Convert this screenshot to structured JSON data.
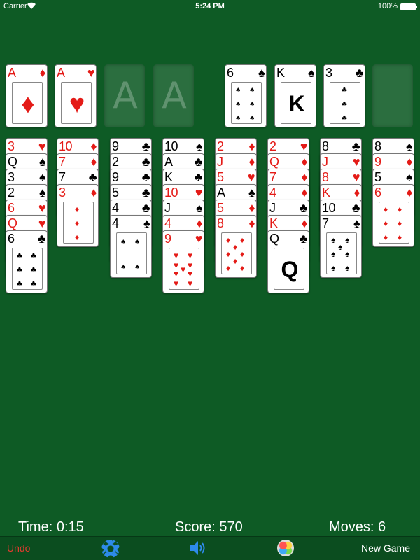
{
  "status": {
    "carrier": "Carrier",
    "time": "5:24 PM",
    "battery": "100%"
  },
  "foundations": [
    {
      "rank": "A",
      "suit": "♦",
      "color": "red"
    },
    {
      "rank": "A",
      "suit": "♥",
      "color": "red"
    },
    {
      "empty_label": "A"
    },
    {
      "empty_label": "A"
    }
  ],
  "free_cells": [
    {
      "rank": "6",
      "suit": "♠",
      "color": "black",
      "pips": 6
    },
    {
      "rank": "K",
      "suit": "♠",
      "color": "black",
      "face": "K"
    },
    {
      "rank": "3",
      "suit": "♣",
      "color": "black",
      "pips": 3
    },
    {
      "empty": true
    }
  ],
  "tableau": [
    [
      {
        "rank": "3",
        "suit": "♥",
        "color": "red"
      },
      {
        "rank": "Q",
        "suit": "♠",
        "color": "black"
      },
      {
        "rank": "3",
        "suit": "♠",
        "color": "black"
      },
      {
        "rank": "2",
        "suit": "♠",
        "color": "black"
      },
      {
        "rank": "6",
        "suit": "♥",
        "color": "red"
      },
      {
        "rank": "Q",
        "suit": "♥",
        "color": "red"
      },
      {
        "rank": "6",
        "suit": "♣",
        "color": "black",
        "pips": 6
      }
    ],
    [
      {
        "rank": "10",
        "suit": "♦",
        "color": "red"
      },
      {
        "rank": "7",
        "suit": "♦",
        "color": "red"
      },
      {
        "rank": "7",
        "suit": "♣",
        "color": "black"
      },
      {
        "rank": "3",
        "suit": "♦",
        "color": "red",
        "pips": 3
      }
    ],
    [
      {
        "rank": "9",
        "suit": "♣",
        "color": "black"
      },
      {
        "rank": "2",
        "suit": "♣",
        "color": "black"
      },
      {
        "rank": "9",
        "suit": "♣",
        "color": "black"
      },
      {
        "rank": "5",
        "suit": "♣",
        "color": "black"
      },
      {
        "rank": "4",
        "suit": "♣",
        "color": "black"
      },
      {
        "rank": "4",
        "suit": "♠",
        "color": "black",
        "pips": 4
      }
    ],
    [
      {
        "rank": "10",
        "suit": "♠",
        "color": "black"
      },
      {
        "rank": "A",
        "suit": "♣",
        "color": "black"
      },
      {
        "rank": "K",
        "suit": "♣",
        "color": "black"
      },
      {
        "rank": "10",
        "suit": "♥",
        "color": "red"
      },
      {
        "rank": "J",
        "suit": "♠",
        "color": "black"
      },
      {
        "rank": "4",
        "suit": "♦",
        "color": "red"
      },
      {
        "rank": "9",
        "suit": "♥",
        "color": "red",
        "pips": 9
      }
    ],
    [
      {
        "rank": "2",
        "suit": "♦",
        "color": "red"
      },
      {
        "rank": "J",
        "suit": "♦",
        "color": "red"
      },
      {
        "rank": "5",
        "suit": "♥",
        "color": "red"
      },
      {
        "rank": "A",
        "suit": "♠",
        "color": "black"
      },
      {
        "rank": "5",
        "suit": "♦",
        "color": "red"
      },
      {
        "rank": "8",
        "suit": "♦",
        "color": "red",
        "pips": 8
      }
    ],
    [
      {
        "rank": "2",
        "suit": "♥",
        "color": "red"
      },
      {
        "rank": "Q",
        "suit": "♦",
        "color": "red"
      },
      {
        "rank": "7",
        "suit": "♦",
        "color": "red"
      },
      {
        "rank": "4",
        "suit": "♦",
        "color": "red"
      },
      {
        "rank": "J",
        "suit": "♣",
        "color": "black"
      },
      {
        "rank": "K",
        "suit": "♦",
        "color": "red"
      },
      {
        "rank": "Q",
        "suit": "♣",
        "color": "black",
        "face": "Q"
      }
    ],
    [
      {
        "rank": "8",
        "suit": "♣",
        "color": "black"
      },
      {
        "rank": "J",
        "suit": "♥",
        "color": "red"
      },
      {
        "rank": "8",
        "suit": "♥",
        "color": "red"
      },
      {
        "rank": "K",
        "suit": "♦",
        "color": "red"
      },
      {
        "rank": "10",
        "suit": "♣",
        "color": "black"
      },
      {
        "rank": "7",
        "suit": "♠",
        "color": "black",
        "pips": 7
      }
    ],
    [
      {
        "rank": "8",
        "suit": "♠",
        "color": "black"
      },
      {
        "rank": "9",
        "suit": "♦",
        "color": "red"
      },
      {
        "rank": "5",
        "suit": "♠",
        "color": "black"
      },
      {
        "rank": "6",
        "suit": "♦",
        "color": "red",
        "pips": 6
      }
    ]
  ],
  "info": {
    "time": "Time: 0:15",
    "score": "Score: 570",
    "moves": "Moves: 6"
  },
  "toolbar": {
    "undo_label": "Undo",
    "settings_icon": "gear-icon",
    "sound_icon": "speaker-icon",
    "game_center_icon": "game-center-icon",
    "new_game_label": "New Game"
  },
  "colors": {
    "felt": "#0e5b25",
    "red_suit": "#e41b17",
    "accent": "#2e8bea",
    "undo": "#e23b2f"
  }
}
